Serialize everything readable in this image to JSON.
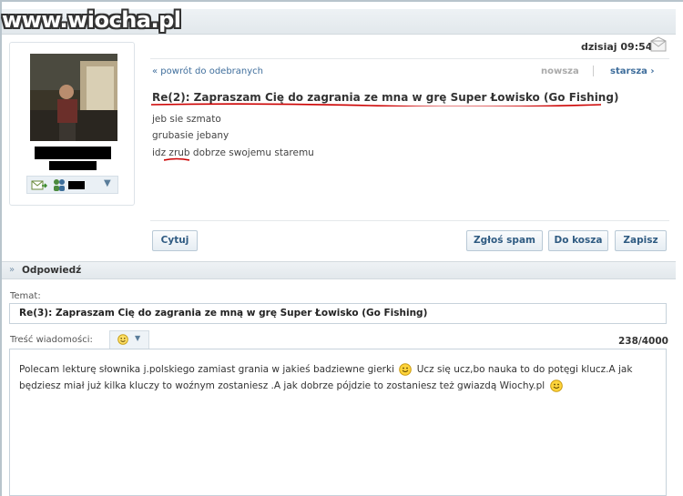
{
  "watermark": "www.wiocha.pl",
  "message": {
    "date": "dzisiaj 09:54",
    "back_link": "« powrót do odebranych",
    "newer": "nowsza",
    "older": "starsza ›",
    "subject": "Re(2): Zapraszam Cię do zagrania ze mna w grę Super Łowisko (Go Fishing)",
    "body": [
      "jeb sie szmato",
      " grubasie jebany",
      "idz zrub dobrze swojemu staremu"
    ]
  },
  "buttons": {
    "quote": "Cytuj",
    "spam": "Zgłoś spam",
    "trash": "Do kosza",
    "save": "Zapisz"
  },
  "reply": {
    "section_title": "Odpowiedź",
    "topic_label": "Temat:",
    "topic_value": "Re(3): Zapraszam Cię do zagrania ze mną w grę Super Łowisko (Go Fishing)",
    "content_label": "Treść wiadomości:",
    "counter": "238/4000",
    "text_line1_a": "Polecam lekturę słownika j.polskiego zamiast grania w jakieś badziewne gierki",
    "text_line1_b": "Ucz się ucz,bo nauka to do potęgi klucz.A jak",
    "text_line2": "będziesz miał już kilka kluczy to woźnym zostaniesz .A jak dobrze pójdzie to zostaniesz też gwiazdą Wiochy.pl"
  },
  "colors": {
    "link": "#3f6e9c",
    "underline": "#cc0000",
    "header_bg": "#e6ecf0"
  }
}
